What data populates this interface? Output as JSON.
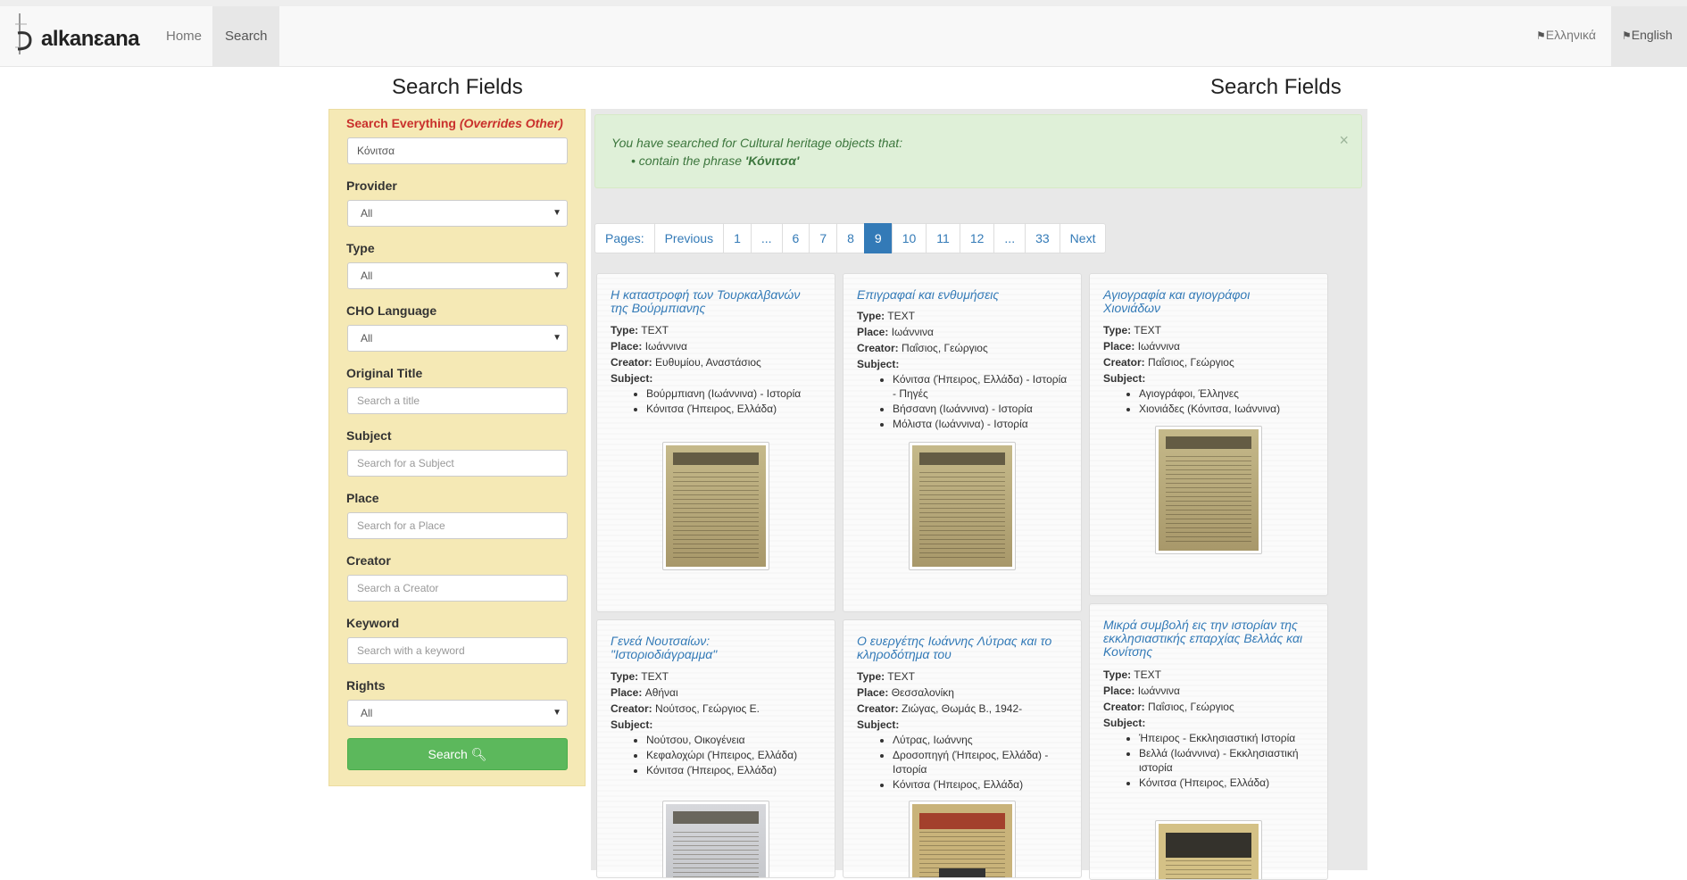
{
  "nav": {
    "logo_text": "alkanɛana",
    "home": "Home",
    "search": "Search",
    "lang_el": "Ελληνικά",
    "lang_en": "English"
  },
  "headings": {
    "left": "Search Fields",
    "right": "Search Fields"
  },
  "form": {
    "search_everything_label": "Search Everything",
    "search_everything_note": "(Overrides Other)",
    "search_everything_value": "Κόνιτσα",
    "provider_label": "Provider",
    "provider_value": "All",
    "type_label": "Type",
    "type_value": "All",
    "cho_language_label": "CHO Language",
    "cho_language_value": "All",
    "original_title_label": "Original Title",
    "original_title_placeholder": "Search a title",
    "subject_label": "Subject",
    "subject_placeholder": "Search for a Subject",
    "place_label": "Place",
    "place_placeholder": "Search for a Place",
    "creator_label": "Creator",
    "creator_placeholder": "Search a Creator",
    "keyword_label": "Keyword",
    "keyword_placeholder": "Search with a keyword",
    "rights_label": "Rights",
    "rights_value": "All",
    "search_button": "Search"
  },
  "alert": {
    "line1": "You have searched for Cultural heritage objects that:",
    "line2_prefix": "contain the phrase ",
    "line2_phrase": "'Κόνιτσα'",
    "close": "×"
  },
  "pagination": [
    "Pages:",
    "Previous",
    "1",
    "...",
    "6",
    "7",
    "8",
    "9",
    "10",
    "11",
    "12",
    "...",
    "33",
    "Next"
  ],
  "pagination_active": "9",
  "labels": {
    "type": "Type:",
    "place": "Place:",
    "creator": "Creator:",
    "subject": "Subject:"
  },
  "cards": [
    {
      "title": "Η καταστροφή των Τουρκαλβανών της Βούρμπιανης",
      "type": "TEXT",
      "place": "Ιωάννινα",
      "creator": "Ευθυμίου, Αναστάσιος",
      "subjects": [
        "Βούρμπιανη (Ιωάννινα) - Ιστορία",
        "Κόνιτσα (Ήπειρος, Ελλάδα)"
      ]
    },
    {
      "title": "Επιγραφαί και ενθυμήσεις",
      "type": "TEXT",
      "place": "Ιωάννινα",
      "creator": "Παΐσιος, Γεώργιος",
      "subjects": [
        "Κόνιτσα (Ήπειρος, Ελλάδα) - Ιστορία - Πηγές",
        "Βήσσανη (Ιωάννινα) - Ιστορία",
        "Μόλιστα (Ιωάννινα) - Ιστορία"
      ]
    },
    {
      "title": "Αγιογραφία και αγιογράφοι Χιονιάδων",
      "type": "TEXT",
      "place": "Ιωάννινα",
      "creator": "Παΐσιος, Γεώργιος",
      "subjects": [
        "Αγιογράφοι, Έλληνες",
        "Χιονιάδες (Κόνιτσα, Ιωάννινα)"
      ]
    },
    {
      "title": "Γενεά Νουτσαίων: \"Ιστοριοδιάγραμμα\"",
      "type": "TEXT",
      "place": "Αθήναι",
      "creator": "Νούτσος, Γεώργιος Ε.",
      "subjects": [
        "Νούτσου, Οικογένεια",
        "Κεφαλοχώρι (Ήπειρος, Ελλάδα)",
        "Κόνιτσα (Ήπειρος, Ελλάδα)"
      ]
    },
    {
      "title": "Ο ευεργέτης Ιωάννης Λύτρας και το κληροδότημα του",
      "type": "TEXT",
      "place": "Θεσσαλονίκη",
      "creator": "Ζιώγας, Θωμάς Β., 1942-",
      "subjects": [
        "Λύτρας, Ιωάννης",
        "Δροσοπηγή (Ήπειρος, Ελλάδα) - Ιστορία",
        "Κόνιτσα (Ήπειρος, Ελλάδα)"
      ]
    },
    {
      "title": "Μικρά συμβολή εις την ιστορίαν της εκκλησιαστικής επαρχίας Βελλάς και Κονίτσης",
      "type": "TEXT",
      "place": "Ιωάννινα",
      "creator": "Παΐσιος, Γεώργιος",
      "subjects": [
        "Ήπειρος - Εκκλησιαστική Ιστορία",
        "Βελλά (Ιωάννινα) - Εκκλησιαστική ιστορία",
        "Κόνιτσα (Ήπειρος, Ελλάδα)"
      ]
    }
  ]
}
